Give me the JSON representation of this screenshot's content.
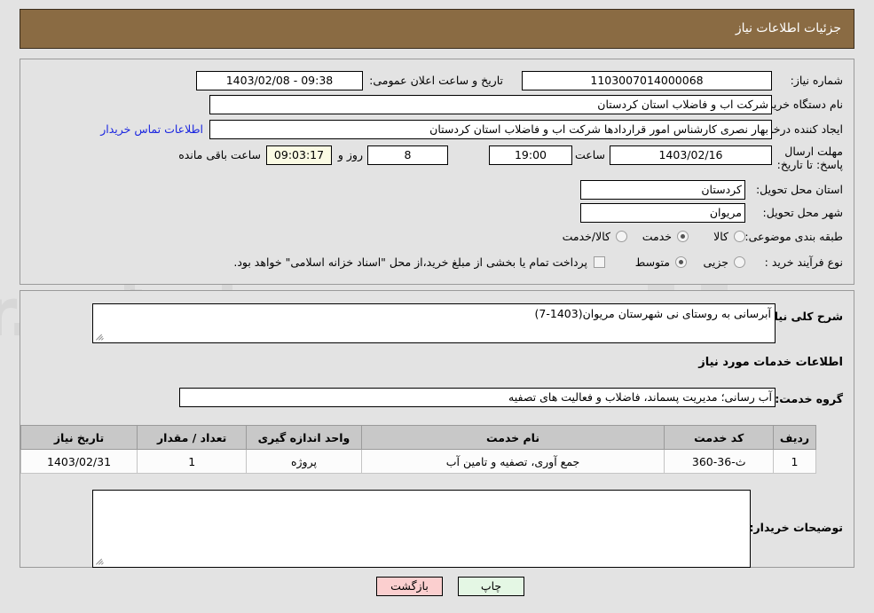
{
  "header": {
    "title": "جزئیات اطلاعات نیاز",
    "bg_color": "#8a6b43",
    "text_color": "#ffffff"
  },
  "colors": {
    "page_bg": "#e3e3e3",
    "panel_border": "#9a9a9a",
    "link": "#1a25e0",
    "timer_bg": "#fbfbe4",
    "table_header_bg": "#c8c8c8",
    "btn_back_bg": "#fbcfcf",
    "btn_print_bg": "#e4f7e4"
  },
  "watermark": {
    "text": "anaTender.net"
  },
  "form": {
    "need_number": {
      "label": "شماره نیاز:",
      "value": "1103007014000068"
    },
    "public_announcement": {
      "label": "تاریخ و ساعت اعلان عمومی:",
      "value": "09:38 - 1403/02/08"
    },
    "buyer_org": {
      "label": "نام دستگاه خریدار:",
      "value": "شرکت اب و فاضلاب استان کردستان"
    },
    "requester": {
      "label": "ایجاد کننده درخواست:",
      "value": "بهار نصری کارشناس امور قراردادها شرکت اب و فاضلاب استان کردستان",
      "contact_link": "اطلاعات تماس خریدار"
    },
    "deadline": {
      "label": "مهلت ارسال پاسخ: تا تاریخ:",
      "date": "1403/02/16",
      "time_label": "ساعت",
      "time": "19:00",
      "days_value": "8",
      "days_label": "روز و",
      "countdown": "09:03:17",
      "remaining_label": "ساعت باقی مانده"
    },
    "delivery_province": {
      "label": "استان محل تحویل:",
      "value": "کردستان"
    },
    "delivery_city": {
      "label": "شهر محل تحویل:",
      "value": "مریوان"
    },
    "subject_class": {
      "label": "طبقه بندی موضوعی:",
      "options": [
        {
          "label": "کالا",
          "selected": false
        },
        {
          "label": "خدمت",
          "selected": true
        },
        {
          "label": "کالا/خدمت",
          "selected": false
        }
      ]
    },
    "purchase_process": {
      "label": "نوع فرآیند خرید :",
      "options": [
        {
          "label": "جزیی",
          "selected": false
        },
        {
          "label": "متوسط",
          "selected": true
        }
      ],
      "checkbox_label": "پرداخت تمام یا بخشی از مبلغ خرید،از محل \"اسناد خزانه اسلامی\" خواهد بود.",
      "checkbox_checked": false
    }
  },
  "details": {
    "general_description": {
      "label": "شرح کلی نیاز:",
      "value": "آبرسانی به روستای نی شهرستان مریوان(1403-7)",
      "placeholder": ""
    },
    "services_section_title": "اطلاعات خدمات مورد نیاز",
    "service_group": {
      "label": "گروه خدمت:",
      "value": "آب رسانی؛ مدیریت پسماند، فاضلاب و فعالیت های تصفیه"
    },
    "buyer_notes": {
      "label": "توضیحات خریدار:",
      "value": "",
      "placeholder": ""
    }
  },
  "table": {
    "columns": [
      "ردیف",
      "کد خدمت",
      "نام خدمت",
      "واحد اندازه گیری",
      "تعداد / مقدار",
      "تاریخ نیاز"
    ],
    "rows": [
      {
        "row_no": "1",
        "service_code": "ث-36-360",
        "service_name": "جمع آوری، تصفیه و تامین آب",
        "unit": "پروژه",
        "quantity": "1",
        "need_date": "1403/02/31"
      }
    ]
  },
  "footer": {
    "back_label": "بازگشت",
    "print_label": "چاپ"
  }
}
